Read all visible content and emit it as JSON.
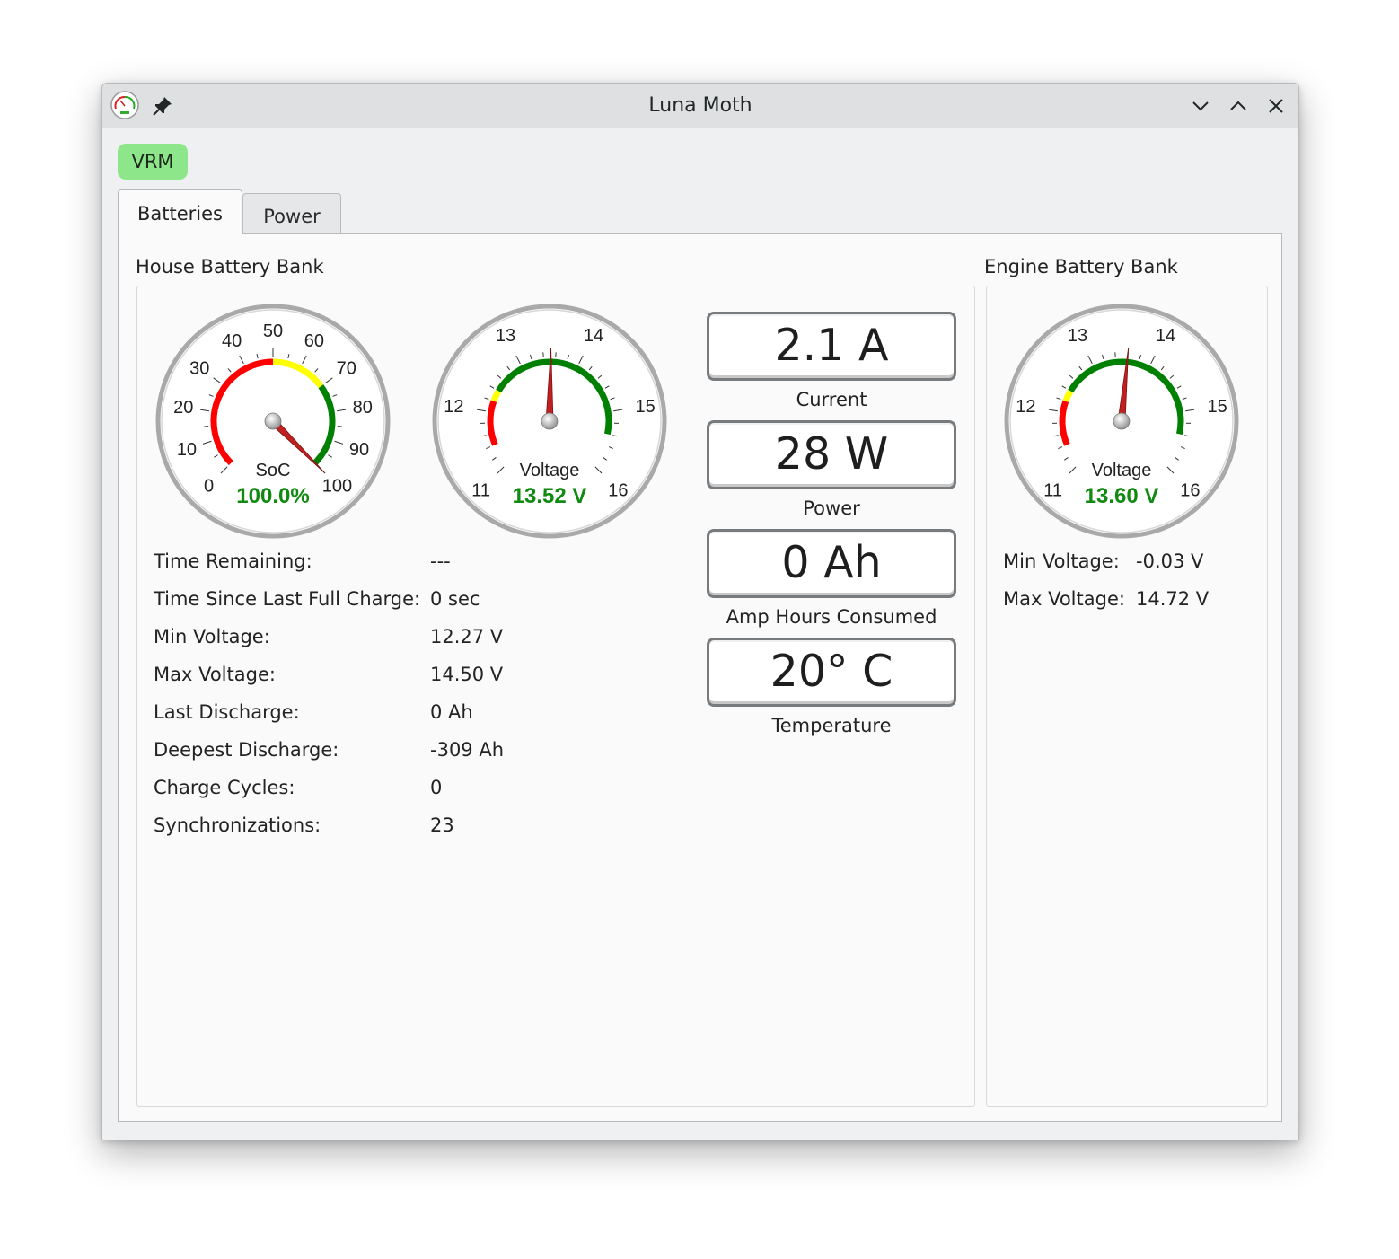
{
  "window": {
    "title": "Luna Moth",
    "buttons": [
      "minimize",
      "maximize",
      "close"
    ]
  },
  "toolbar": {
    "vrm_label": "VRM"
  },
  "tabs": [
    {
      "label": "Batteries",
      "active": true
    },
    {
      "label": "Power",
      "active": false
    }
  ],
  "house": {
    "title": "House Battery Bank",
    "soc_gauge": {
      "label": "SoC",
      "value_text": "100.0%",
      "value": 100.0,
      "min": 0,
      "max": 100,
      "ticks": [
        "0",
        "10",
        "20",
        "30",
        "40",
        "50",
        "60",
        "70",
        "80",
        "90",
        "100"
      ],
      "bands": [
        {
          "from": 0,
          "to": 50,
          "color": "#ff0000"
        },
        {
          "from": 50,
          "to": 70,
          "color": "#ffff00"
        },
        {
          "from": 70,
          "to": 100,
          "color": "#008000"
        }
      ]
    },
    "voltage_gauge": {
      "label": "Voltage",
      "value_text": "13.52 V",
      "value": 13.52,
      "min": 11,
      "max": 16,
      "ticks": [
        "11",
        "12",
        "13",
        "14",
        "15",
        "16"
      ],
      "bands": [
        {
          "from": 11.4,
          "to": 12.2,
          "color": "#ff0000"
        },
        {
          "from": 12.2,
          "to": 12.4,
          "color": "#ffff00"
        },
        {
          "from": 12.4,
          "to": 15.4,
          "color": "#008000"
        }
      ]
    },
    "stats": [
      {
        "label": "Time Remaining:",
        "value": "---"
      },
      {
        "label": "Time Since Last Full Charge:",
        "value": "0 sec"
      },
      {
        "label": "Min Voltage:",
        "value": "12.27 V"
      },
      {
        "label": "Max Voltage:",
        "value": "14.50 V"
      },
      {
        "label": "Last Discharge:",
        "value": "0 Ah"
      },
      {
        "label": "Deepest Discharge:",
        "value": "-309 Ah"
      },
      {
        "label": "Charge Cycles:",
        "value": "0"
      },
      {
        "label": "Synchronizations:",
        "value": "23"
      }
    ],
    "displays": [
      {
        "value": "2.1 A",
        "caption": "Current"
      },
      {
        "value": "28 W",
        "caption": "Power"
      },
      {
        "value": "0 Ah",
        "caption": "Amp Hours Consumed"
      },
      {
        "value": "20° C",
        "caption": "Temperature"
      }
    ]
  },
  "engine": {
    "title": "Engine Battery Bank",
    "voltage_gauge": {
      "label": "Voltage",
      "value_text": "13.60 V",
      "value": 13.6,
      "min": 11,
      "max": 16,
      "ticks": [
        "11",
        "12",
        "13",
        "14",
        "15",
        "16"
      ],
      "bands": [
        {
          "from": 11.4,
          "to": 12.2,
          "color": "#ff0000"
        },
        {
          "from": 12.2,
          "to": 12.4,
          "color": "#ffff00"
        },
        {
          "from": 12.4,
          "to": 15.4,
          "color": "#008000"
        }
      ]
    },
    "stats": [
      {
        "label": "Min Voltage:",
        "value": "-0.03 V"
      },
      {
        "label": "Max Voltage:",
        "value": "14.72 V"
      }
    ]
  },
  "colors": {
    "value_green": "#118a11",
    "needle_red": "#c0201f",
    "vrm_green": "#8ee68b"
  }
}
